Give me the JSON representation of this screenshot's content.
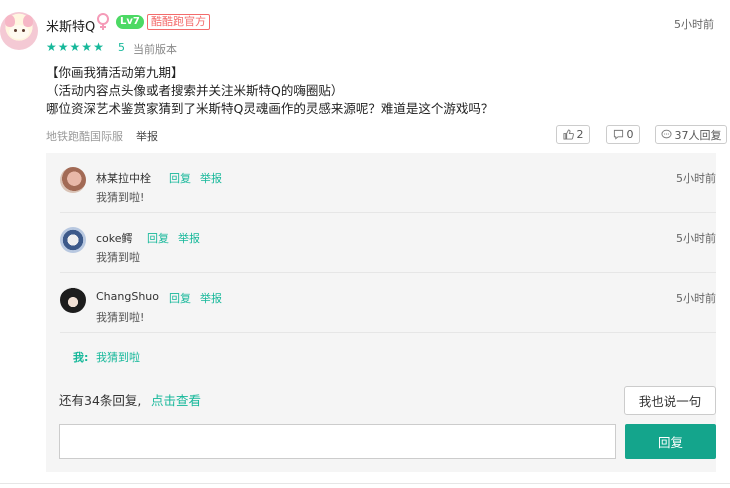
{
  "post": {
    "username": "米斯特Q",
    "level": "Lv7",
    "official_badge": "酷酷跑官方",
    "time": "5小时前",
    "rating": "5",
    "version_label": "当前版本",
    "content_lines": [
      "【你画我猜活动第九期】",
      "（活动内容点头像或者搜索并关注米斯特Q的嗨圈贴）",
      "哪位资深艺术鉴赏家猜到了米斯特Q灵魂画作的灵感来源呢？难道是这个游戏吗？"
    ],
    "device": "地铁跑酷国际服",
    "report": "举报",
    "like_count": "2",
    "dislike_count": "0",
    "reply_count_label": "37人回复"
  },
  "replies": [
    {
      "name": "林某拉中栓",
      "reply": "回复",
      "report": "举报",
      "time": "5小时前",
      "text": "我猜到啦!"
    },
    {
      "name": "coke鳄",
      "reply": "回复",
      "report": "举报",
      "time": "5小时前",
      "text": "我猜到啦"
    },
    {
      "name": "ChangShuo",
      "reply": "回复",
      "report": "举报",
      "time": "5小时前",
      "text": "我猜到啦!"
    }
  ],
  "my_reply": {
    "label": "我:",
    "text": "我猜到啦"
  },
  "footer": {
    "more_text": "还有34条回复,",
    "more_link": "点击查看",
    "say_button": "我也说一句",
    "reply_button": "回复",
    "input_placeholder": ""
  },
  "colors": {
    "accent": "#16b89a",
    "button": "#14a58c",
    "badge": "#4cd964",
    "official": "#f36b6b"
  }
}
